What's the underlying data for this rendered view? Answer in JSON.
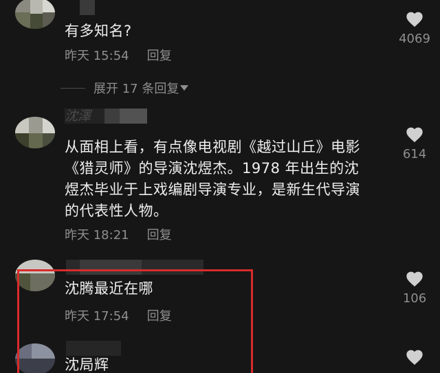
{
  "comments": [
    {
      "content_lines": [
        "有多知名?"
      ],
      "time": "昨天 15:54",
      "reply_label": "回复",
      "likes": "4069",
      "expand_label": "展开 17 条回复"
    },
    {
      "username": "沈澤",
      "content_lines": [
        "从面相上看，有点像电视剧《越过山丘》电影",
        "《猎灵师》的导演沈煜杰。1978 年出生的沈",
        "煜杰毕业于上戏编剧导演专业，是新生代导演",
        "的代表性人物。"
      ],
      "time": "昨天 18:21",
      "reply_label": "回复",
      "likes": "614"
    },
    {
      "content_lines": [
        "沈腾最近在哪"
      ],
      "time": "昨天 17:54",
      "reply_label": "回复",
      "likes": "106"
    },
    {
      "content_lines": [
        "沈局辉"
      ],
      "likes": ""
    }
  ],
  "colors": {
    "background": "#161616",
    "text": "#eeeeee",
    "meta": "#8f8f8f",
    "highlight": "#d92b2b"
  },
  "icons": {
    "like": "heart-icon",
    "expand": "triangle-down-icon"
  }
}
